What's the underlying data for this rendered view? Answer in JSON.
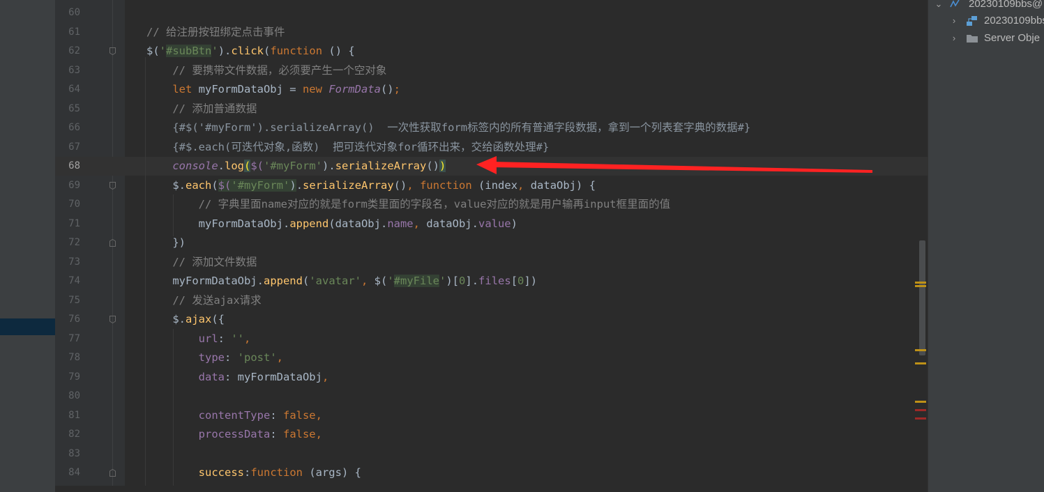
{
  "colors": {
    "keyword": "#cc7832",
    "string": "#6a8759",
    "function": "#ffc66d",
    "property": "#9876aa",
    "comment": "#808080",
    "text": "#a9b7c6",
    "arrow": "#ff2222"
  },
  "project_tree": {
    "items": [
      {
        "label": "20230109bbs@",
        "icon": "database-icon",
        "expanded": true
      },
      {
        "label": "20230109bbs",
        "icon": "schema-icon",
        "expanded": false
      },
      {
        "label": "Server Obje",
        "icon": "folder-icon",
        "expanded": false
      }
    ]
  },
  "editor": {
    "current_line": "68",
    "lines": [
      {
        "num": "60",
        "tokens": []
      },
      {
        "num": "61",
        "tokens": [
          {
            "t": "// 给注册按钮绑定点击事件",
            "c": "cmt"
          }
        ]
      },
      {
        "num": "62",
        "tokens": [
          {
            "t": "$(",
            "c": ""
          },
          {
            "t": "'",
            "c": "str"
          },
          {
            "t": "#subBtn",
            "c": "str selhl"
          },
          {
            "t": "'",
            "c": "str"
          },
          {
            "t": ").",
            "c": ""
          },
          {
            "t": "click",
            "c": "fn"
          },
          {
            "t": "(",
            "c": ""
          },
          {
            "t": "function",
            "c": "kw"
          },
          {
            "t": " () {",
            "c": ""
          }
        ]
      },
      {
        "num": "63",
        "tokens": [
          {
            "t": "    // 要携带文件数据，必须要产生一个空对象",
            "c": "cmt"
          }
        ]
      },
      {
        "num": "64",
        "tokens": [
          {
            "t": "    ",
            "c": ""
          },
          {
            "t": "let",
            "c": "kw"
          },
          {
            "t": " myFormDataObj = ",
            "c": ""
          },
          {
            "t": "new",
            "c": "kw"
          },
          {
            "t": " ",
            "c": ""
          },
          {
            "t": "FormData",
            "c": "prop it"
          },
          {
            "t": "()",
            "c": ""
          },
          {
            "t": ";",
            "c": "kw"
          }
        ]
      },
      {
        "num": "65",
        "tokens": [
          {
            "t": "    // 添加普通数据",
            "c": "cmt"
          }
        ]
      },
      {
        "num": "66",
        "tokens": [
          {
            "t": "    {#$('#myForm').serializeArray()  一次性获取form标签内的所有普通字段数据，拿到一个列表套字典的数据#}",
            "c": "tpl"
          }
        ]
      },
      {
        "num": "67",
        "tokens": [
          {
            "t": "    {#$.each(可迭代对象,函数)  把可迭代对象for循环出来，交给函数处理#}",
            "c": "tpl"
          }
        ]
      },
      {
        "num": "68",
        "tokens": [
          {
            "t": "    ",
            "c": ""
          },
          {
            "t": "console",
            "c": "prop it"
          },
          {
            "t": ".",
            "c": ""
          },
          {
            "t": "log",
            "c": "fn"
          },
          {
            "t": "(",
            "c": "brace"
          },
          {
            "t": "$(",
            "c": "prop"
          },
          {
            "t": "'#myForm'",
            "c": "str"
          },
          {
            "t": ").",
            "c": ""
          },
          {
            "t": "serializeArray",
            "c": "fn"
          },
          {
            "t": "()",
            "c": ""
          },
          {
            "t": ")",
            "c": "brace"
          }
        ]
      },
      {
        "num": "69",
        "tokens": [
          {
            "t": "    ",
            "c": ""
          },
          {
            "t": "$",
            "c": ""
          },
          {
            "t": ".",
            "c": ""
          },
          {
            "t": "each",
            "c": "fn"
          },
          {
            "t": "(",
            "c": ""
          },
          {
            "t": "$(",
            "c": "prop selhl"
          },
          {
            "t": "'#myForm'",
            "c": "str selhl"
          },
          {
            "t": ")",
            "c": "selhl"
          },
          {
            "t": ".",
            "c": ""
          },
          {
            "t": "serializeArray",
            "c": "fn"
          },
          {
            "t": "()",
            "c": ""
          },
          {
            "t": ",",
            "c": "kw"
          },
          {
            "t": " ",
            "c": ""
          },
          {
            "t": "function",
            "c": "kw"
          },
          {
            "t": " (index",
            "c": ""
          },
          {
            "t": ",",
            "c": "kw"
          },
          {
            "t": " dataObj) {",
            "c": ""
          }
        ]
      },
      {
        "num": "70",
        "tokens": [
          {
            "t": "        // 字典里面name对应的就是form类里面的字段名，value对应的就是用户输再input框里面的值",
            "c": "cmt"
          }
        ]
      },
      {
        "num": "71",
        "tokens": [
          {
            "t": "        myFormDataObj.",
            "c": ""
          },
          {
            "t": "append",
            "c": "fn"
          },
          {
            "t": "(dataObj.",
            "c": ""
          },
          {
            "t": "name",
            "c": "prop"
          },
          {
            "t": ",",
            "c": "kw"
          },
          {
            "t": " dataObj.",
            "c": ""
          },
          {
            "t": "value",
            "c": "prop"
          },
          {
            "t": ")",
            "c": ""
          }
        ]
      },
      {
        "num": "72",
        "tokens": [
          {
            "t": "    })",
            "c": ""
          }
        ]
      },
      {
        "num": "73",
        "tokens": [
          {
            "t": "    // 添加文件数据",
            "c": "cmt"
          }
        ]
      },
      {
        "num": "74",
        "tokens": [
          {
            "t": "    myFormDataObj.",
            "c": ""
          },
          {
            "t": "append",
            "c": "fn"
          },
          {
            "t": "(",
            "c": ""
          },
          {
            "t": "'avatar'",
            "c": "str"
          },
          {
            "t": ",",
            "c": "kw"
          },
          {
            "t": " $(",
            "c": ""
          },
          {
            "t": "'",
            "c": "str"
          },
          {
            "t": "#myFile",
            "c": "str selhl"
          },
          {
            "t": "'",
            "c": "str"
          },
          {
            "t": ")[",
            "c": ""
          },
          {
            "t": "0",
            "c": "str"
          },
          {
            "t": "].",
            "c": ""
          },
          {
            "t": "files",
            "c": "prop"
          },
          {
            "t": "[",
            "c": ""
          },
          {
            "t": "0",
            "c": "str"
          },
          {
            "t": "])",
            "c": ""
          }
        ]
      },
      {
        "num": "75",
        "tokens": [
          {
            "t": "    // 发送ajax请求",
            "c": "cmt"
          }
        ]
      },
      {
        "num": "76",
        "tokens": [
          {
            "t": "    $.",
            "c": ""
          },
          {
            "t": "ajax",
            "c": "fn"
          },
          {
            "t": "({",
            "c": ""
          }
        ]
      },
      {
        "num": "77",
        "tokens": [
          {
            "t": "        ",
            "c": ""
          },
          {
            "t": "url",
            "c": "prop"
          },
          {
            "t": ": ",
            "c": ""
          },
          {
            "t": "''",
            "c": "str"
          },
          {
            "t": ",",
            "c": "kw"
          }
        ]
      },
      {
        "num": "78",
        "tokens": [
          {
            "t": "        ",
            "c": ""
          },
          {
            "t": "type",
            "c": "prop"
          },
          {
            "t": ": ",
            "c": ""
          },
          {
            "t": "'post'",
            "c": "str"
          },
          {
            "t": ",",
            "c": "kw"
          }
        ]
      },
      {
        "num": "79",
        "tokens": [
          {
            "t": "        ",
            "c": ""
          },
          {
            "t": "data",
            "c": "prop"
          },
          {
            "t": ": myFormDataObj",
            "c": ""
          },
          {
            "t": ",",
            "c": "kw"
          }
        ]
      },
      {
        "num": "80",
        "tokens": []
      },
      {
        "num": "81",
        "tokens": [
          {
            "t": "        ",
            "c": ""
          },
          {
            "t": "contentType",
            "c": "prop"
          },
          {
            "t": ": ",
            "c": ""
          },
          {
            "t": "false",
            "c": "kw"
          },
          {
            "t": ",",
            "c": "kw"
          }
        ]
      },
      {
        "num": "82",
        "tokens": [
          {
            "t": "        ",
            "c": ""
          },
          {
            "t": "processData",
            "c": "prop"
          },
          {
            "t": ": ",
            "c": ""
          },
          {
            "t": "false",
            "c": "kw"
          },
          {
            "t": ",",
            "c": "kw"
          }
        ]
      },
      {
        "num": "83",
        "tokens": []
      },
      {
        "num": "84",
        "tokens": [
          {
            "t": "        ",
            "c": ""
          },
          {
            "t": "success",
            "c": "fn"
          },
          {
            "t": ":",
            "c": ""
          },
          {
            "t": "function",
            "c": "kw"
          },
          {
            "t": " (args) {",
            "c": ""
          }
        ]
      }
    ]
  }
}
